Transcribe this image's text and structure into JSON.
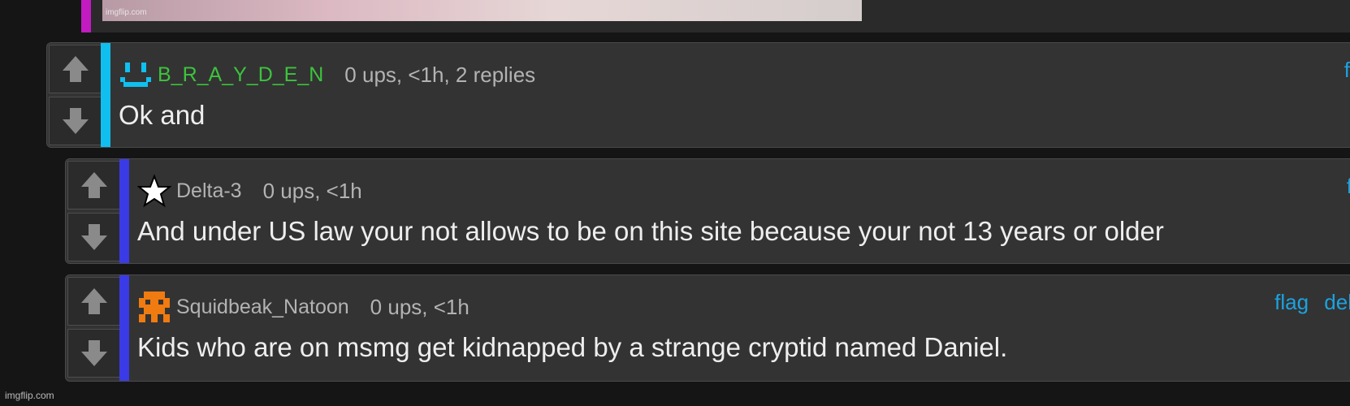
{
  "top_image": {
    "watermark": "imgflip.com",
    "accent_color": "#c21bc2"
  },
  "comments": [
    {
      "username": "B_R_A_Y_D_E_N",
      "username_color": "#3cc43c",
      "accent_color": "#10bfef",
      "avatar_icon": "smiley-face-icon",
      "meta": "0 ups, <1h, 2 replies",
      "text": "Ok and",
      "flag_label": "f"
    },
    {
      "username": "Delta-3",
      "username_color": "#b3b3b3",
      "accent_color": "#3a3ae6",
      "avatar_icon": "star-icon",
      "meta": "0 ups, <1h",
      "text": "And under US law your not allows to be on this site because your not 13 years or older",
      "flag_label": "f"
    },
    {
      "username": "Squidbeak_Natoon",
      "username_color": "#b3b3b3",
      "accent_color": "#3a3ae6",
      "avatar_icon": "pixel-squid-icon",
      "meta": "0 ups, <1h",
      "text": "Kids who are on msmg get kidnapped by a strange cryptid named Daniel.",
      "flag_label": "flag",
      "delete_label": "del"
    }
  ],
  "corner_watermark": "imgflip.com"
}
